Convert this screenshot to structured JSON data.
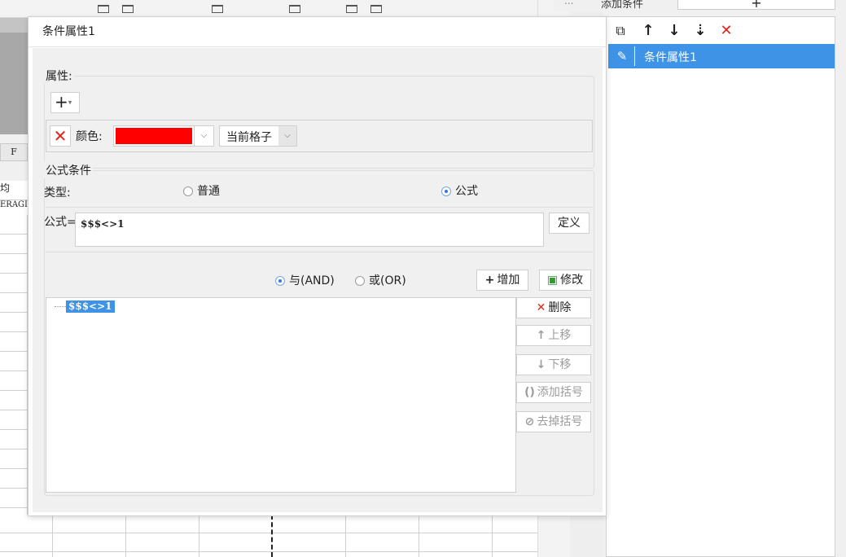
{
  "background": {
    "column_header": "F",
    "cells": [
      "均",
      "ERAGI"
    ],
    "top_label": "添加条件",
    "top_plus": "+",
    "top_sb": "..."
  },
  "right_panel": {
    "toolbar_icons": [
      "copy-icon",
      "arrow-up-icon",
      "arrow-down-icon",
      "sort-down-icon",
      "delete-icon"
    ],
    "toolbar_glyphs": [
      "⧉",
      "↑",
      "↓",
      "⇣",
      "✕"
    ],
    "items": [
      {
        "label": "条件属性1",
        "selected": true
      }
    ]
  },
  "dialog": {
    "title": "条件属性1",
    "properties": {
      "legend": "属性:",
      "add_glyph": "+",
      "row": {
        "remove_glyph": "✕",
        "color_label": "颜色:",
        "color_value": "#ff0000",
        "scope_value": "当前格子"
      }
    },
    "formula_condition": {
      "legend": "公式条件",
      "type_label": "类型:",
      "type_options": [
        {
          "label": "普通",
          "selected": false
        },
        {
          "label": "公式",
          "selected": true
        }
      ],
      "formula_label": "公式=",
      "formula_value": "$$$<>1",
      "define_button": "定义",
      "logic_options": [
        {
          "label": "与(AND)",
          "selected": true
        },
        {
          "label": "或(OR)",
          "selected": false
        }
      ],
      "add_button": "增加",
      "modify_button": "修改",
      "conditions": [
        "$$$<>1"
      ],
      "side_buttons": {
        "delete": "删除",
        "move_up": "上移",
        "move_down": "下移",
        "add_bracket": "添加括号",
        "remove_bracket": "去掉括号"
      }
    }
  }
}
